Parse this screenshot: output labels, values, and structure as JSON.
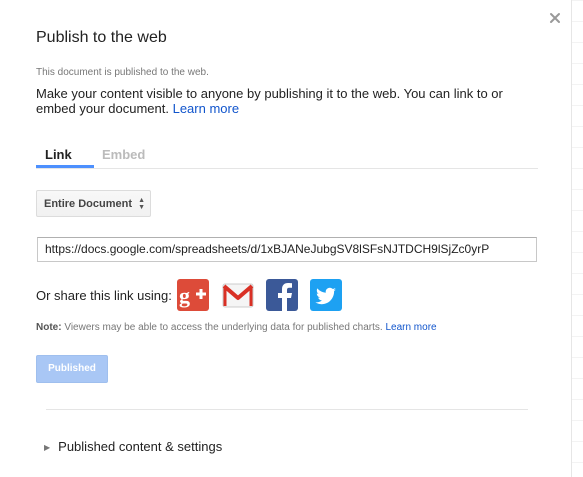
{
  "dialog": {
    "title": "Publish to the web",
    "status": "This document is published to the web.",
    "description": "Make your content visible to anyone by publishing it to the web. You can link to or embed your document.",
    "learn_more": "Learn more"
  },
  "tabs": [
    {
      "label": "Link",
      "active": true
    },
    {
      "label": "Embed",
      "active": false
    }
  ],
  "scope_select": {
    "value": "Entire Document"
  },
  "url": {
    "value": "https://docs.google.com/spreadsheets/d/1xBJANeJubgSV8lSFsNJTDCH9lSjZc0yrP"
  },
  "share": {
    "label": "Or share this link using:",
    "icons": [
      "google-plus-icon",
      "gmail-icon",
      "facebook-icon",
      "twitter-icon"
    ]
  },
  "note": {
    "prefix": "Note:",
    "text": " Viewers may be able to access the underlying data for published charts. ",
    "learn_more": "Learn more"
  },
  "published_button": {
    "label": "Published"
  },
  "settings": {
    "label": "Published content & settings"
  },
  "colors": {
    "link": "#1155cc",
    "tab_underline": "#4d90fe",
    "published_button": "#a9c7f5",
    "gplus": "#dd4b39",
    "facebook": "#3b5998",
    "twitter": "#1da1f2"
  }
}
